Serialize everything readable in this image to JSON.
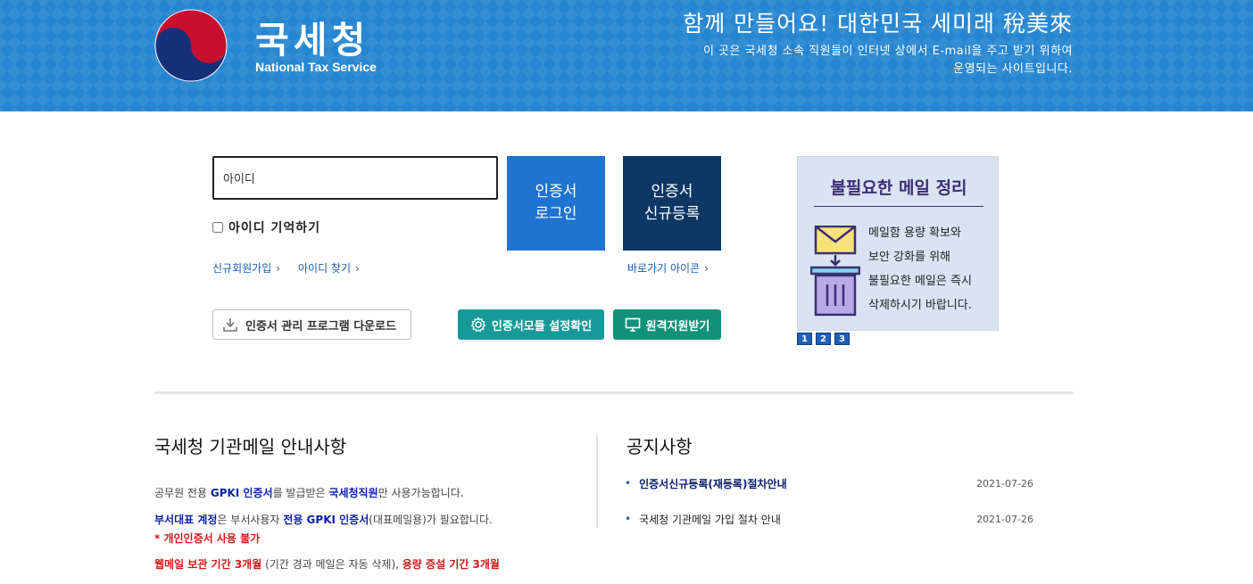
{
  "header": {
    "logo_ko": "국세청",
    "logo_en": "National Tax Service",
    "slogan": "함께 만들어요! 대한민국 세미래 稅美來",
    "desc_line1": "이 곳은 국세청 소속 직원들이 인터넷 상에서 E-mail을 주고 받기 위하여",
    "desc_line2": "운영되는 사이트입니다."
  },
  "login": {
    "id_value": "아이디",
    "remember_label": "아이디 기억하기",
    "signup_link": "신규회원가입",
    "find_id_link": "아이디 찾기",
    "shortcut_link": "바로가기 아이콘",
    "cert_login_l1": "인증서",
    "cert_login_l2": "로그인",
    "cert_reg_l1": "인증서",
    "cert_reg_l2": "신규등록",
    "download_label": "인증서 관리 프로그램 다운로드",
    "module_label": "인증서모듈 설정확인",
    "remote_label": "원격지원받기"
  },
  "banner": {
    "title": "불필요한 메일 정리",
    "lines": [
      "메일함 용량 확보와",
      "보안 강화를 위해",
      "불필요한 메일은 즉시",
      "삭제하시기 바랍니다."
    ],
    "pages": [
      "1",
      "2",
      "3"
    ]
  },
  "guide": {
    "title": "국세청 기관메일 안내사항",
    "l1_a": "공무원 전용 ",
    "l1_b": "GPKI 인증서",
    "l1_c": "를 발급받은 ",
    "l1_d": "국세청직원",
    "l1_e": "만 사용가능합니다.",
    "l2_a": "부서대표 계정",
    "l2_b": "은 부서사용자 ",
    "l2_c": "전용 GPKI 인증서",
    "l2_d": "(대표메일용)가 필요합니다.",
    "l3": "* 개인인증서 사용 불가",
    "l4_a": "웹메일 보관 기간 3개월",
    "l4_b": " (기간 경과 메일은 자동 삭제), ",
    "l4_c": "용량 증설 기간 3개월"
  },
  "notices": {
    "title": "공지사항",
    "items": [
      {
        "title": "인증서신규등록(재등록)절차안내",
        "date": "2021-07-26"
      },
      {
        "title": "국세청 기관메일 가입 절차 안내",
        "date": "2021-07-26"
      }
    ]
  }
}
